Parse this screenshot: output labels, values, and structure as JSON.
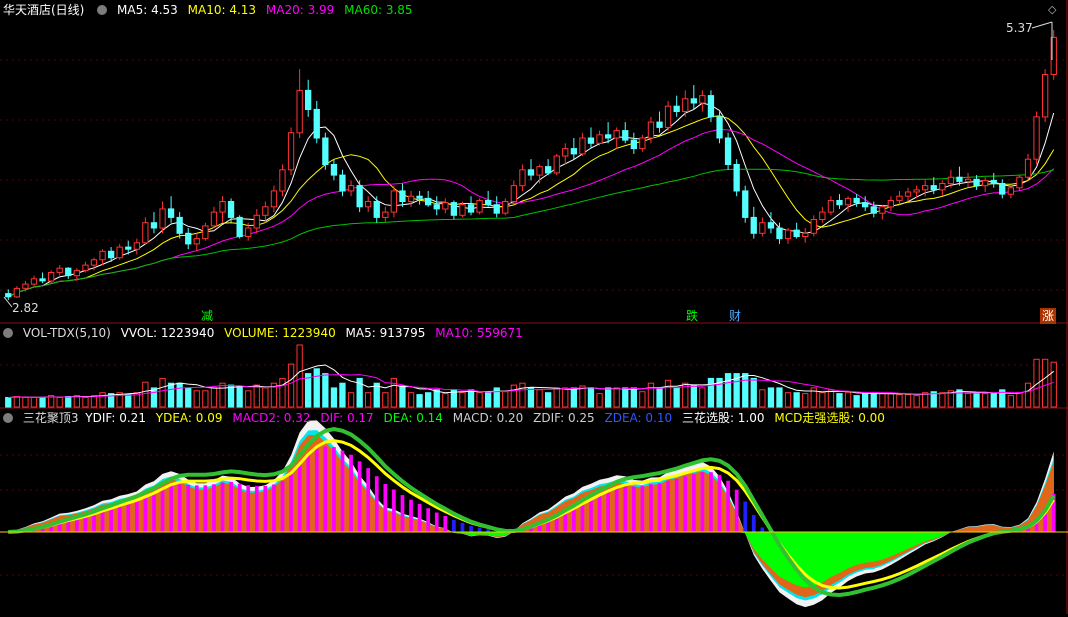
{
  "price": {
    "title": "华天酒店(日线)",
    "ma": [
      {
        "label": "MA5: 4.53",
        "color": "#ffffff"
      },
      {
        "label": "MA10: 4.13",
        "color": "#ffff00"
      },
      {
        "label": "MA20: 3.99",
        "color": "#ff00ff"
      },
      {
        "label": "MA60: 3.85",
        "color": "#00e000"
      }
    ],
    "high_label": "5.37",
    "low_label": "2.82",
    "markers": [
      {
        "text": "减",
        "color": "#00ff00",
        "bg": "#000"
      },
      {
        "text": "跌",
        "color": "#00ff00",
        "bg": "#000"
      },
      {
        "text": "财",
        "color": "#4aa8ff",
        "bg": "#000"
      },
      {
        "text": "涨",
        "color": "#ffffff",
        "bg": "#aa3300"
      }
    ]
  },
  "volume": {
    "title": "VOL-TDX(5,10)",
    "fields": [
      {
        "label": "VVOL: 1223940",
        "color": "#ffffff"
      },
      {
        "label": "VOLUME: 1223940",
        "color": "#ffff00"
      },
      {
        "label": "MA5: 913795",
        "color": "#ffffff"
      },
      {
        "label": "MA10: 559671",
        "color": "#ff00ff"
      }
    ]
  },
  "indicator": {
    "title": "三花聚顶3",
    "fields": [
      {
        "label": "YDIF: 0.21",
        "color": "#ffffff"
      },
      {
        "label": "YDEA: 0.09",
        "color": "#ffff00"
      },
      {
        "label": "MACD2: 0.32",
        "color": "#ff00ff"
      },
      {
        "label": "DIF: 0.17",
        "color": "#ff00ff"
      },
      {
        "label": "DEA: 0.14",
        "color": "#00ff00"
      },
      {
        "label": "MACD: 0.20",
        "color": "#cccccc"
      },
      {
        "label": "ZDIF: 0.25",
        "color": "#cccccc"
      },
      {
        "label": "ZDEA: 0.10",
        "color": "#3355ff"
      },
      {
        "label": "三花选股: 1.00",
        "color": "#ffffff"
      },
      {
        "label": "MCD走强选股: 0.00",
        "color": "#ffff00"
      }
    ]
  },
  "chart_data": {
    "type": "candlestick",
    "ohlc": [
      [
        2.88,
        2.92,
        2.82,
        2.85
      ],
      [
        2.85,
        2.95,
        2.84,
        2.93
      ],
      [
        2.93,
        3.0,
        2.9,
        2.97
      ],
      [
        2.97,
        3.05,
        2.95,
        3.02
      ],
      [
        3.02,
        3.08,
        2.98,
        3.0
      ],
      [
        3.0,
        3.1,
        2.98,
        3.08
      ],
      [
        3.08,
        3.15,
        3.05,
        3.12
      ],
      [
        3.12,
        3.13,
        3.02,
        3.05
      ],
      [
        3.05,
        3.12,
        3.0,
        3.1
      ],
      [
        3.1,
        3.18,
        3.08,
        3.15
      ],
      [
        3.15,
        3.22,
        3.1,
        3.2
      ],
      [
        3.2,
        3.3,
        3.15,
        3.28
      ],
      [
        3.28,
        3.32,
        3.18,
        3.22
      ],
      [
        3.22,
        3.35,
        3.2,
        3.32
      ],
      [
        3.32,
        3.38,
        3.25,
        3.3
      ],
      [
        3.3,
        3.4,
        3.25,
        3.36
      ],
      [
        3.36,
        3.6,
        3.34,
        3.55
      ],
      [
        3.55,
        3.65,
        3.45,
        3.5
      ],
      [
        3.5,
        3.75,
        3.45,
        3.68
      ],
      [
        3.68,
        3.8,
        3.55,
        3.6
      ],
      [
        3.6,
        3.65,
        3.4,
        3.45
      ],
      [
        3.45,
        3.5,
        3.3,
        3.35
      ],
      [
        3.35,
        3.45,
        3.28,
        3.4
      ],
      [
        3.4,
        3.55,
        3.38,
        3.52
      ],
      [
        3.52,
        3.7,
        3.5,
        3.65
      ],
      [
        3.65,
        3.8,
        3.55,
        3.75
      ],
      [
        3.75,
        3.78,
        3.55,
        3.6
      ],
      [
        3.6,
        3.62,
        3.4,
        3.42
      ],
      [
        3.42,
        3.55,
        3.38,
        3.5
      ],
      [
        3.5,
        3.68,
        3.45,
        3.62
      ],
      [
        3.62,
        3.75,
        3.55,
        3.7
      ],
      [
        3.7,
        3.9,
        3.65,
        3.85
      ],
      [
        3.85,
        4.1,
        3.8,
        4.05
      ],
      [
        4.05,
        4.45,
        4.0,
        4.4
      ],
      [
        4.4,
        5.0,
        4.35,
        4.8
      ],
      [
        4.8,
        4.9,
        4.55,
        4.62
      ],
      [
        4.62,
        4.7,
        4.3,
        4.35
      ],
      [
        4.35,
        4.4,
        4.05,
        4.1
      ],
      [
        4.1,
        4.15,
        3.95,
        4.0
      ],
      [
        4.0,
        4.05,
        3.8,
        3.85
      ],
      [
        3.85,
        3.95,
        3.8,
        3.9
      ],
      [
        3.9,
        3.95,
        3.65,
        3.7
      ],
      [
        3.7,
        3.8,
        3.65,
        3.75
      ],
      [
        3.75,
        3.8,
        3.55,
        3.6
      ],
      [
        3.6,
        3.7,
        3.55,
        3.65
      ],
      [
        3.65,
        3.9,
        3.6,
        3.85
      ],
      [
        3.85,
        3.92,
        3.7,
        3.75
      ],
      [
        3.75,
        3.85,
        3.7,
        3.8
      ],
      [
        3.8,
        3.85,
        3.72,
        3.78
      ],
      [
        3.78,
        3.85,
        3.7,
        3.72
      ],
      [
        3.72,
        3.8,
        3.62,
        3.68
      ],
      [
        3.68,
        3.78,
        3.64,
        3.74
      ],
      [
        3.74,
        3.76,
        3.58,
        3.62
      ],
      [
        3.62,
        3.75,
        3.6,
        3.72
      ],
      [
        3.72,
        3.8,
        3.62,
        3.65
      ],
      [
        3.65,
        3.78,
        3.63,
        3.76
      ],
      [
        3.76,
        3.85,
        3.7,
        3.72
      ],
      [
        3.72,
        3.8,
        3.6,
        3.64
      ],
      [
        3.64,
        3.78,
        3.62,
        3.75
      ],
      [
        3.75,
        3.95,
        3.72,
        3.9
      ],
      [
        3.9,
        4.1,
        3.85,
        4.05
      ],
      [
        4.05,
        4.15,
        3.95,
        4.0
      ],
      [
        4.0,
        4.1,
        3.92,
        4.08
      ],
      [
        4.08,
        4.15,
        4.0,
        4.02
      ],
      [
        4.02,
        4.2,
        4.0,
        4.18
      ],
      [
        4.18,
        4.3,
        4.1,
        4.25
      ],
      [
        4.25,
        4.35,
        4.15,
        4.2
      ],
      [
        4.2,
        4.4,
        4.18,
        4.35
      ],
      [
        4.35,
        4.45,
        4.25,
        4.3
      ],
      [
        4.3,
        4.42,
        4.28,
        4.38
      ],
      [
        4.38,
        4.5,
        4.3,
        4.35
      ],
      [
        4.35,
        4.45,
        4.25,
        4.42
      ],
      [
        4.42,
        4.5,
        4.3,
        4.33
      ],
      [
        4.33,
        4.4,
        4.2,
        4.25
      ],
      [
        4.25,
        4.38,
        4.22,
        4.35
      ],
      [
        4.35,
        4.55,
        4.3,
        4.5
      ],
      [
        4.5,
        4.6,
        4.4,
        4.45
      ],
      [
        4.45,
        4.7,
        4.42,
        4.65
      ],
      [
        4.65,
        4.75,
        4.55,
        4.6
      ],
      [
        4.6,
        4.8,
        4.55,
        4.72
      ],
      [
        4.72,
        4.85,
        4.62,
        4.68
      ],
      [
        4.68,
        4.8,
        4.6,
        4.75
      ],
      [
        4.75,
        4.8,
        4.5,
        4.55
      ],
      [
        4.55,
        4.6,
        4.3,
        4.35
      ],
      [
        4.35,
        4.4,
        4.05,
        4.1
      ],
      [
        4.1,
        4.15,
        3.8,
        3.85
      ],
      [
        3.85,
        3.9,
        3.55,
        3.6
      ],
      [
        3.6,
        3.7,
        3.4,
        3.45
      ],
      [
        3.45,
        3.6,
        3.42,
        3.55
      ],
      [
        3.55,
        3.65,
        3.45,
        3.5
      ],
      [
        3.5,
        3.55,
        3.35,
        3.4
      ],
      [
        3.4,
        3.5,
        3.35,
        3.48
      ],
      [
        3.48,
        3.55,
        3.4,
        3.42
      ],
      [
        3.42,
        3.5,
        3.36,
        3.45
      ],
      [
        3.45,
        3.62,
        3.42,
        3.58
      ],
      [
        3.58,
        3.7,
        3.55,
        3.65
      ],
      [
        3.65,
        3.8,
        3.62,
        3.76
      ],
      [
        3.76,
        3.82,
        3.68,
        3.72
      ],
      [
        3.72,
        3.8,
        3.65,
        3.78
      ],
      [
        3.78,
        3.82,
        3.7,
        3.74
      ],
      [
        3.74,
        3.8,
        3.66,
        3.7
      ],
      [
        3.7,
        3.75,
        3.6,
        3.64
      ],
      [
        3.64,
        3.72,
        3.58,
        3.7
      ],
      [
        3.7,
        3.8,
        3.66,
        3.76
      ],
      [
        3.76,
        3.85,
        3.72,
        3.8
      ],
      [
        3.8,
        3.88,
        3.75,
        3.84
      ],
      [
        3.84,
        3.9,
        3.78,
        3.86
      ],
      [
        3.86,
        3.95,
        3.8,
        3.9
      ],
      [
        3.9,
        3.98,
        3.82,
        3.86
      ],
      [
        3.86,
        3.95,
        3.8,
        3.92
      ],
      [
        3.92,
        4.05,
        3.88,
        3.98
      ],
      [
        3.98,
        4.08,
        3.9,
        3.94
      ],
      [
        3.94,
        4.02,
        3.88,
        3.96
      ],
      [
        3.96,
        4.0,
        3.86,
        3.9
      ],
      [
        3.9,
        3.98,
        3.84,
        3.95
      ],
      [
        3.95,
        4.02,
        3.88,
        3.92
      ],
      [
        3.92,
        3.96,
        3.78,
        3.82
      ],
      [
        3.82,
        3.9,
        3.78,
        3.88
      ],
      [
        3.88,
        4.0,
        3.85,
        3.98
      ],
      [
        3.98,
        4.2,
        3.95,
        4.15
      ],
      [
        4.15,
        4.6,
        4.1,
        4.55
      ],
      [
        4.55,
        5.0,
        4.5,
        4.95
      ],
      [
        4.95,
        5.37,
        4.9,
        5.3
      ]
    ],
    "ylim": [
      2.82,
      5.37
    ],
    "indicators": [
      "MA5",
      "MA10",
      "MA20",
      "MA60"
    ]
  }
}
